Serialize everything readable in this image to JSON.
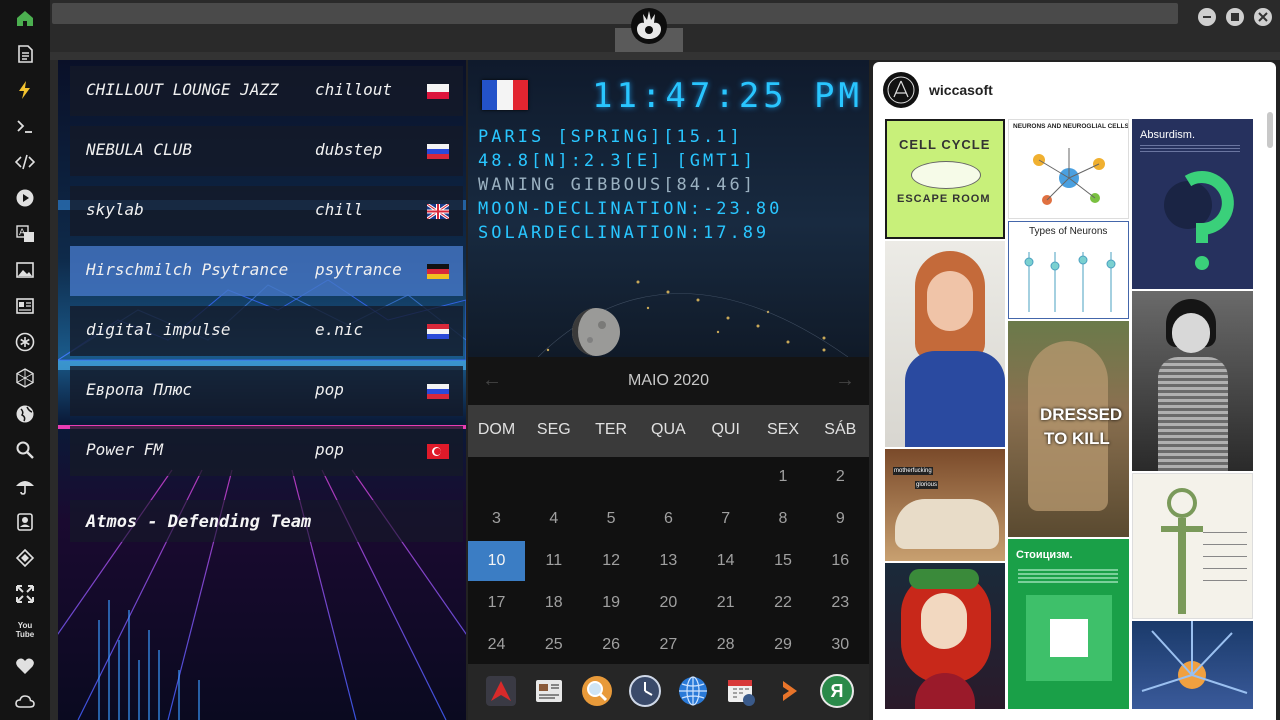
{
  "colors": {
    "accent_blue": "#29c6ff",
    "calendar_today": "#3b7dc4",
    "rail_home": "#4caf50",
    "rail_bolt": "#f4c430"
  },
  "rail": {
    "icons": [
      "home-icon",
      "document-icon",
      "bolt-icon",
      "terminal-icon",
      "code-icon",
      "play-icon",
      "translate-icon",
      "image-icon",
      "news-icon",
      "asterisk-icon",
      "hexagon-icon",
      "globe-icon",
      "search-icon",
      "umbrella-icon",
      "contact-icon",
      "tag-icon",
      "expand-icon",
      "youtube-icon",
      "heart-icon",
      "cloud-icon"
    ],
    "youtube_label": "You\nTube"
  },
  "radio": {
    "stations": [
      {
        "name": "CHILLOUT LOUNGE JAZZ",
        "genre": "chillout",
        "flag": "pl"
      },
      {
        "name": "NEBULA CLUB",
        "genre": "dubstep",
        "flag": "ru"
      },
      {
        "name": "skylab",
        "genre": "chill",
        "flag": "gb"
      },
      {
        "name": "Hirschmilch Psytrance",
        "genre": "psytrance",
        "flag": "de",
        "active": true
      },
      {
        "name": "digital impulse",
        "genre": "e.nic",
        "flag": "hr"
      },
      {
        "name": "Европа Плюс",
        "genre": "pop",
        "flag": "ru"
      },
      {
        "name": "Power FM",
        "genre": "pop",
        "flag": "tr"
      }
    ],
    "now_playing": "Atmos - Defending Team"
  },
  "clock": {
    "time": "11:47:25",
    "ampm": "PM",
    "location": "PARIS [SPRING][15.1]",
    "coords": "48.8[N]:2.3[E] [GMT1]",
    "moon_phase": "WANING GIBBOUS[84.46]",
    "moon_declination": "MOON-DECLINATION:-23.80",
    "solar_declination": "SOLARDECLINATION:17.89"
  },
  "calendar": {
    "title": "MAIO 2020",
    "prev": "←",
    "next": "→",
    "weekdays": [
      "DOM",
      "SEG",
      "TER",
      "QUA",
      "QUI",
      "SEX",
      "SÁB"
    ],
    "rows": [
      [
        "",
        "",
        "",
        "",
        "",
        "1",
        "2"
      ],
      [
        "3",
        "4",
        "5",
        "6",
        "7",
        "8",
        "9"
      ],
      [
        "10",
        "11",
        "12",
        "13",
        "14",
        "15",
        "16"
      ],
      [
        "17",
        "18",
        "19",
        "20",
        "21",
        "22",
        "23"
      ],
      [
        "24",
        "25",
        "26",
        "27",
        "28",
        "29",
        "30"
      ]
    ],
    "today": "10"
  },
  "dock": {
    "items": [
      "app-launcher-icon",
      "news-reader-icon",
      "search-app-icon",
      "clock-app-icon",
      "browser-icon",
      "calendar-app-icon",
      "media-arrow-icon",
      "yandex-icon"
    ],
    "yandex_label": "Я"
  },
  "pinterest": {
    "username": "wiccasoft",
    "tiles": {
      "cell_cycle_1": "CELL CYCLE",
      "cell_cycle_2": "ESCAPE ROOM",
      "neurons_glia": "NEURONS AND NEUROGLIAL CELLS",
      "absurdism": "Absurdism.",
      "types_neurons": "Types of Neurons",
      "dressed_1": "DRESSED",
      "dressed_2": "TO KILL",
      "stoicism": "Стоицизм.",
      "meme_1": "motherfucking",
      "meme_2": "glorious"
    }
  }
}
